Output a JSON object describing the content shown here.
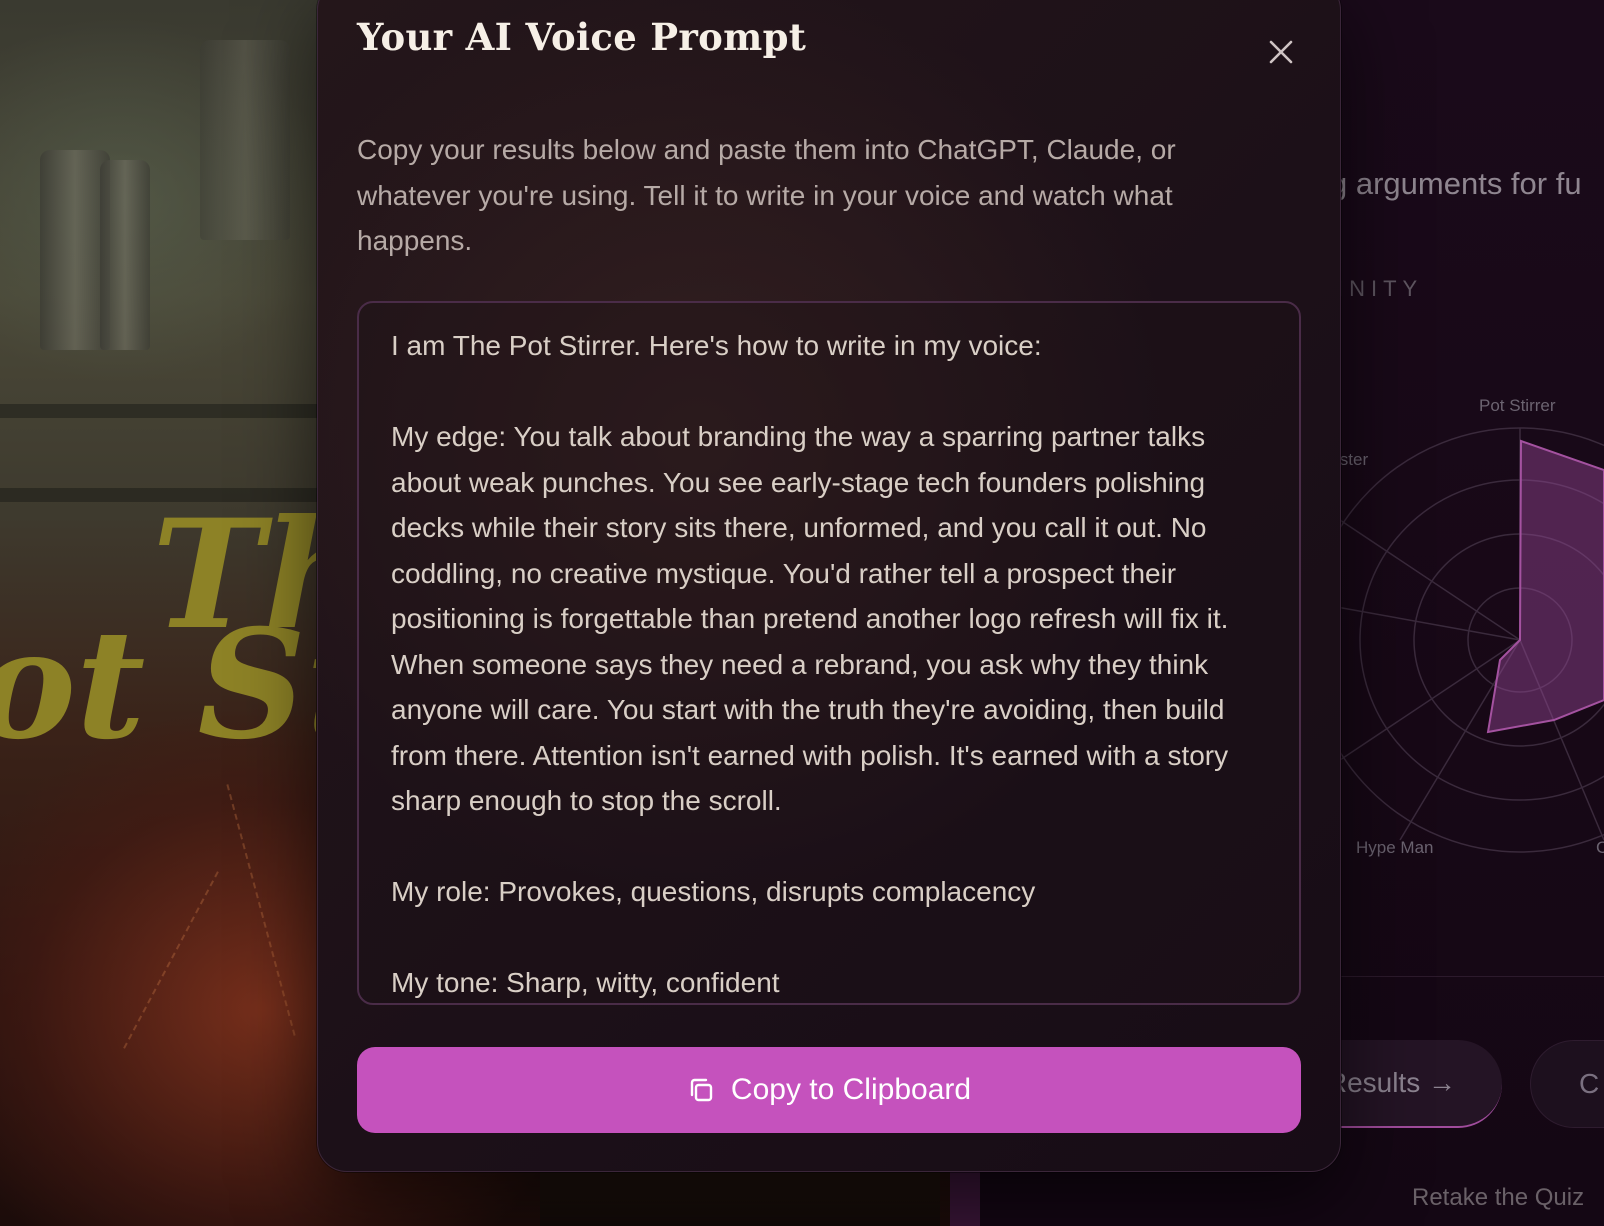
{
  "modal": {
    "title": "Your AI Voice Prompt",
    "description": "Copy your results below and paste them into ChatGPT, Claude, or whatever you're using. Tell it to write in your voice and watch what happens.",
    "prompt": {
      "intro": "I am The Pot Stirrer. Here's how to write in my voice:",
      "edge": "My edge: You talk about branding the way a sparring partner talks about weak punches. You see early-stage tech founders polishing decks while their story sits there, unformed, and you call it out. No coddling, no creative mystique. You'd rather tell a prospect their positioning is forgettable than pretend another logo refresh will fix it. When someone says they need a rebrand, you ask why they think anyone will care. You start with the truth they're avoiding, then build from there. Attention isn't earned with polish. It's earned with a story sharp enough to stop the scroll.",
      "role": "My role: Provokes, questions, disrupts complacency",
      "tone": "My tone: Sharp, witty, confident"
    },
    "copy_button_label": "Copy to Clipboard",
    "close_icon": "close-icon",
    "copy_icon": "copy-icon",
    "accent_color": "#c552bd"
  },
  "background": {
    "hero_title_line1": "Th",
    "hero_title_line2": "ot St",
    "tagline": "g arguments for fu",
    "kicker": "INITY",
    "radar_labels": {
      "top": "Pot Stirrer",
      "left": "ister",
      "bottom_left": "Hype Man",
      "bottom_right": "C"
    },
    "results_button_label": "Results →",
    "second_button_label": "C",
    "retake_label": "Retake the Quiz"
  }
}
